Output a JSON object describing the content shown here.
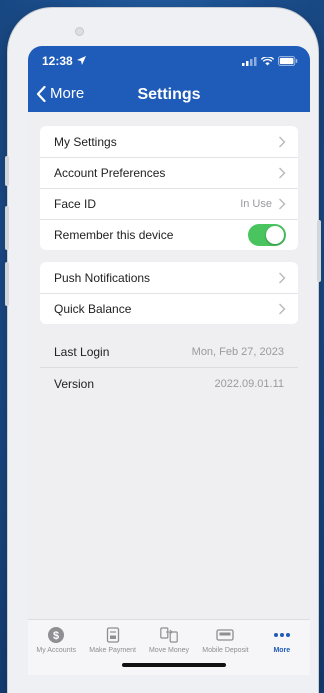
{
  "status": {
    "time": "12:38"
  },
  "nav": {
    "back_label": "More",
    "title": "Settings"
  },
  "group1": [
    {
      "label": "My Settings",
      "detail": ""
    },
    {
      "label": "Account Preferences",
      "detail": ""
    },
    {
      "label": "Face ID",
      "detail": "In Use"
    },
    {
      "label": "Remember this device",
      "toggle_on": true
    }
  ],
  "group2": [
    {
      "label": "Push Notifications"
    },
    {
      "label": "Quick Balance"
    }
  ],
  "info": [
    {
      "label": "Last Login",
      "value": "Mon, Feb 27, 2023"
    },
    {
      "label": "Version",
      "value": "2022.09.01.11"
    }
  ],
  "tabs": [
    {
      "label": "My Accounts",
      "icon": "dollar-circle-icon"
    },
    {
      "label": "Make Payment",
      "icon": "payment-icon"
    },
    {
      "label": "Move Money",
      "icon": "transfer-icon"
    },
    {
      "label": "Mobile Deposit",
      "icon": "deposit-icon"
    },
    {
      "label": "More",
      "icon": "more-dots-icon",
      "active": true
    }
  ],
  "colors": {
    "header": "#1f5bb8",
    "toggle": "#49c45f",
    "active_tab": "#1f5bb8"
  }
}
